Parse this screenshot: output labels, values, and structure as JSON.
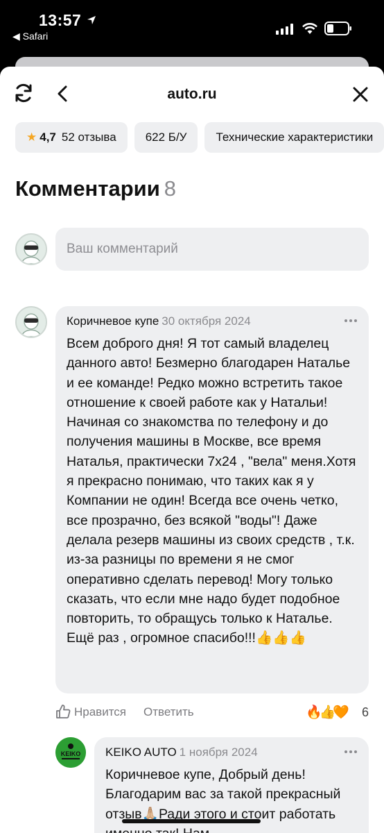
{
  "status_bar": {
    "time": "13:57",
    "back_app": "◀ Safari"
  },
  "nav": {
    "title": "auto.ru"
  },
  "chips": {
    "rating": "4,7",
    "reviews": "52 отзыва",
    "used": "622 Б/У",
    "specs": "Технические характеристики"
  },
  "comments_section": {
    "title": "Комментарии",
    "count": "8",
    "input_placeholder": "Ваш комментарий"
  },
  "comments": [
    {
      "author": "Коричневое купе",
      "date": "30 октября 2024",
      "text": "Всем доброго дня! Я тот самый владелец данного авто! Безмерно благодарен Наталье и ее команде! Редко можно встретить такое отношение к своей работе как у Натальи! Начиная со знакомства по телефону и до получения машины в Москве, все время Наталья, практически 7х24 , \"вела\" меня.Хотя я прекрасно понимаю, что таких как я у Компании не один! Всегда все очень четко, все прозрачно, без всякой \"воды\"! Даже делала резерв машины из своих средств , т.к. из-за разницы по времени я не смог оперативно сделать перевод! Могу только сказать, что если мне надо будет подобное повторить, то обращусь только к Наталье. Ещё раз , огромное спасибо!!!👍👍👍",
      "like_label": "Нравится",
      "reply_label": "Ответить",
      "reactions": "🔥👍🧡",
      "reactions_count": "6"
    },
    {
      "author": "KEIKO AUTO",
      "date": "1 ноября 2024",
      "avatar_text": "KEIKO",
      "text": "Коричневое купе, Добрый день! Благодарим вас за такой прекрасный отзыв🙏🏼Ради этого и стоит работать именно так! Нам"
    }
  ],
  "colors": {
    "bubble": "#eeeff1",
    "star": "#f5a623",
    "keiko_green": "#2c9e33"
  }
}
